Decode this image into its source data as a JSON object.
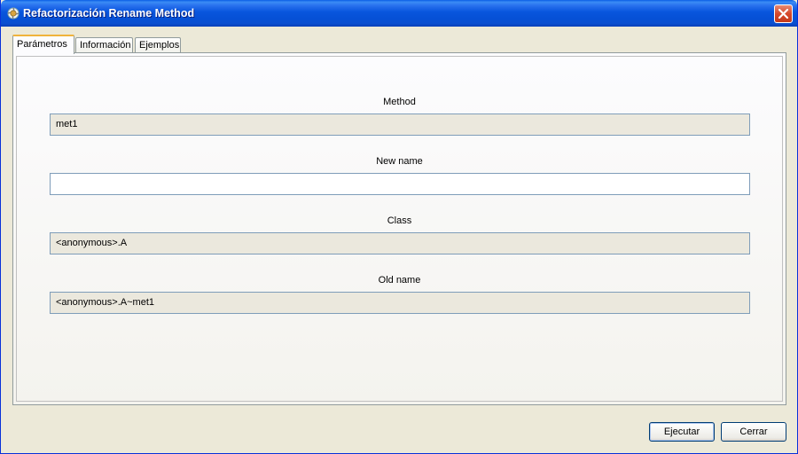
{
  "window": {
    "title": "Refactorización Rename Method"
  },
  "tabs": [
    {
      "label": "Parámetros",
      "active": true
    },
    {
      "label": "Información",
      "active": false
    },
    {
      "label": "Ejemplos",
      "active": false
    }
  ],
  "form": {
    "method": {
      "label": "Method",
      "value": "met1"
    },
    "new_name": {
      "label": "New name",
      "value": ""
    },
    "class": {
      "label": "Class",
      "value": "<anonymous>.A"
    },
    "old_name": {
      "label": "Old name",
      "value": "<anonymous>.A~met1"
    }
  },
  "buttons": {
    "execute": "Ejecutar",
    "close": "Cerrar"
  },
  "colors": {
    "titlebar": "#0855dd",
    "readonly_field": "#ebe8dd",
    "active_tab_accent": "#f0b33c",
    "close_button": "#d6492b"
  },
  "icons": {
    "window": "app-icon",
    "close": "close-icon"
  }
}
